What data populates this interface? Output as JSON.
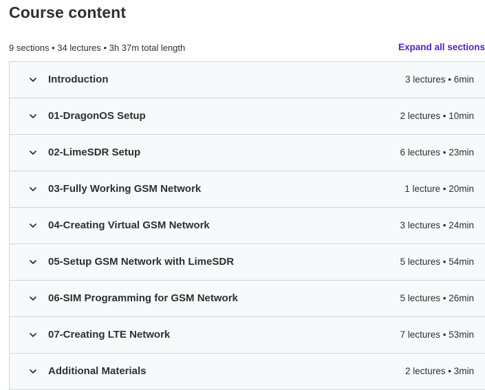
{
  "header": {
    "title": "Course content",
    "summary": "9 sections • 34 lectures • 3h 37m total length",
    "expand_all_label": "Expand all sections"
  },
  "sections": [
    {
      "title": "Introduction",
      "meta": "3 lectures • 6min"
    },
    {
      "title": "01-DragonOS Setup",
      "meta": "2 lectures • 10min"
    },
    {
      "title": "02-LimeSDR Setup",
      "meta": "6 lectures • 23min"
    },
    {
      "title": "03-Fully Working GSM Network",
      "meta": "1 lecture • 20min"
    },
    {
      "title": "04-Creating Virtual GSM Network",
      "meta": "3 lectures • 24min"
    },
    {
      "title": "05-Setup GSM Network with LimeSDR",
      "meta": "5 lectures • 54min"
    },
    {
      "title": "06-SIM Programming for GSM Network",
      "meta": "5 lectures • 26min"
    },
    {
      "title": "07-Creating LTE Network",
      "meta": "7 lectures • 53min"
    },
    {
      "title": "Additional Materials",
      "meta": "2 lectures • 3min"
    }
  ],
  "icons": {
    "chevron": "chevron-down-icon"
  },
  "colors": {
    "accent": "#5022c3",
    "text": "#2d2f31",
    "row_bg": "#f7f9fa",
    "border": "#d1d7dc"
  }
}
